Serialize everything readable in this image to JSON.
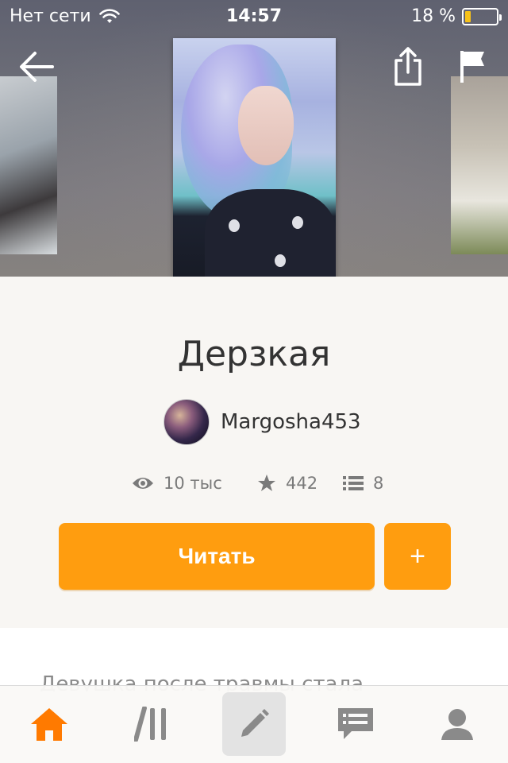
{
  "status_bar": {
    "carrier": "Нет сети",
    "time": "14:57",
    "battery": "18 %",
    "battery_level": 0.18,
    "battery_color": "#f7c21a"
  },
  "header": {
    "back_icon": "back-arrow-icon",
    "share_icon": "share-icon",
    "flag_icon": "flag-icon"
  },
  "story": {
    "title": "Дерзкая",
    "author": "Margosha453",
    "stats": {
      "views": "10 тыс",
      "votes": "442",
      "parts": "8"
    },
    "description": "Девушка после травмы стала"
  },
  "actions": {
    "read_label": "Читать",
    "add_label": "+"
  },
  "tabbar": {
    "items": [
      {
        "name": "home",
        "icon": "home-icon",
        "active": true
      },
      {
        "name": "library",
        "icon": "library-icon"
      },
      {
        "name": "write",
        "icon": "pencil-icon"
      },
      {
        "name": "messages",
        "icon": "messages-icon"
      },
      {
        "name": "profile",
        "icon": "profile-icon"
      }
    ]
  },
  "colors": {
    "accent": "#ff9d0f",
    "active_tab": "#ff7a00",
    "inactive_tab": "#8a8a8a"
  }
}
